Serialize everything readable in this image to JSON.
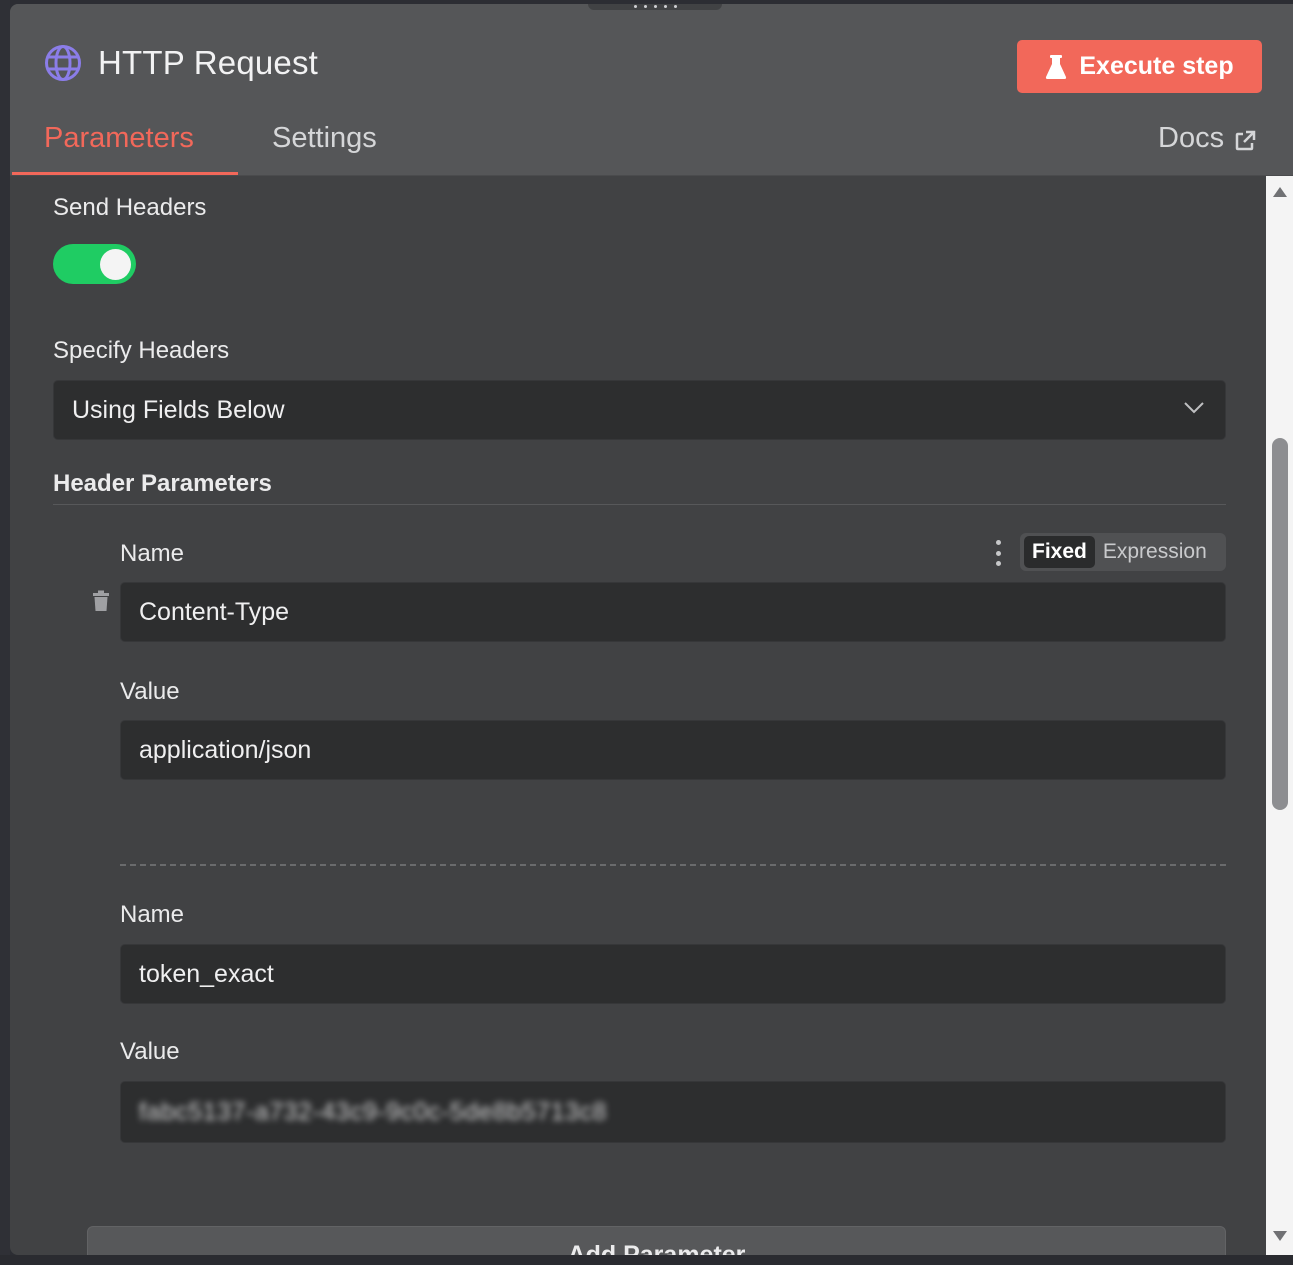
{
  "node": {
    "title": "HTTP Request",
    "execute_label": "Execute step"
  },
  "tabs": {
    "parameters": "Parameters",
    "settings": "Settings",
    "active": "parameters",
    "docs": "Docs"
  },
  "send_headers": {
    "label": "Send Headers",
    "enabled": true
  },
  "specify_headers": {
    "label": "Specify Headers",
    "value": "Using Fields Below"
  },
  "header_parameters": {
    "label": "Header Parameters",
    "mode_fixed": "Fixed",
    "mode_expression": "Expression",
    "items": [
      {
        "name_label": "Name",
        "name_value": "Content-Type",
        "value_label": "Value",
        "value_value": "application/json"
      },
      {
        "name_label": "Name",
        "name_value": "token_exact",
        "value_label": "Value",
        "value_value": "fabc5137-a732-43c9-9c0c-5de8b5713c8"
      }
    ],
    "add_label": "Add Parameter"
  },
  "colors": {
    "accent": "#f2685a",
    "toggle_on": "#1fcc63",
    "globe": "#8b7de8"
  },
  "icons": {
    "node": "globe-icon",
    "execute": "flask-icon",
    "docs": "external-link-icon",
    "delete": "trash-icon",
    "options": "kebab-icon",
    "select": "chevron-down-icon"
  }
}
